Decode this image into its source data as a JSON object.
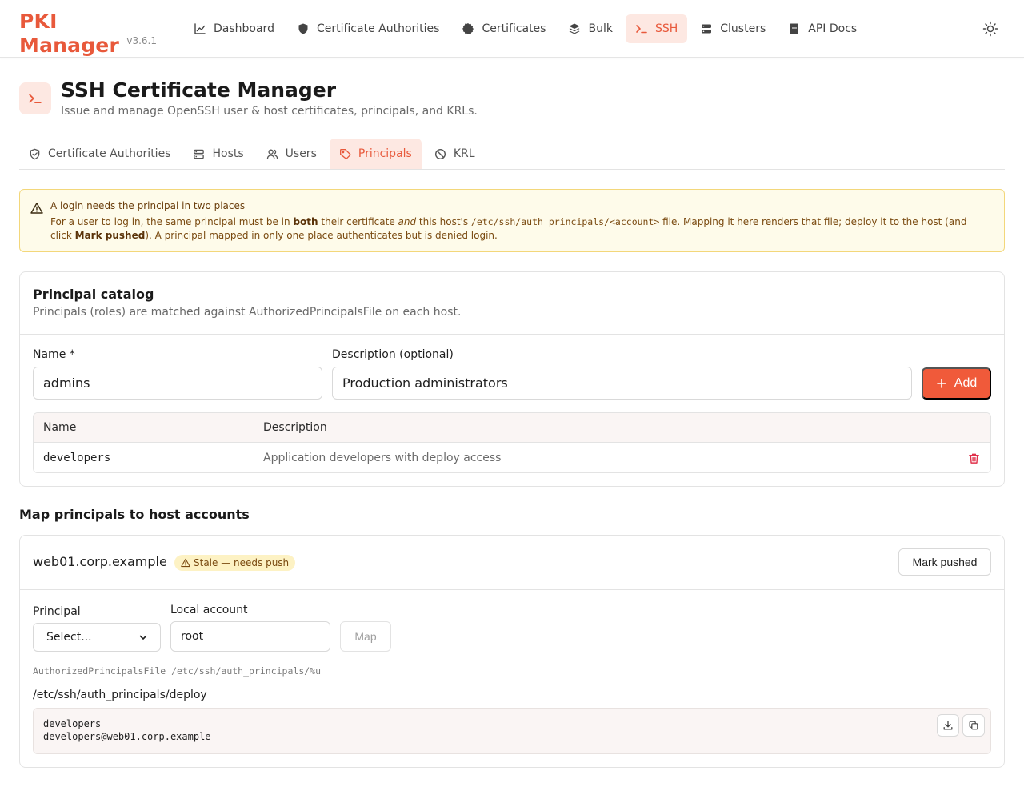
{
  "app": {
    "name": "PKI Manager",
    "version": "v3.6.1"
  },
  "nav": {
    "items": [
      {
        "label": "Dashboard",
        "icon": "chart-line-icon",
        "active": false
      },
      {
        "label": "Certificate Authorities",
        "icon": "shield-icon",
        "active": false
      },
      {
        "label": "Certificates",
        "icon": "badge-icon",
        "active": false
      },
      {
        "label": "Bulk",
        "icon": "layers-icon",
        "active": false
      },
      {
        "label": "SSH",
        "icon": "terminal-icon",
        "active": true
      },
      {
        "label": "Clusters",
        "icon": "server-icon",
        "active": false
      },
      {
        "label": "API Docs",
        "icon": "book-icon",
        "active": false
      }
    ],
    "theme_icon": "sun-icon"
  },
  "page": {
    "title": "SSH Certificate Manager",
    "subtitle": "Issue and manage OpenSSH user & host certificates, principals, and KRLs."
  },
  "subtabs": [
    {
      "label": "Certificate Authorities",
      "icon": "shield-check-icon",
      "active": false
    },
    {
      "label": "Hosts",
      "icon": "server-icon",
      "active": false
    },
    {
      "label": "Users",
      "icon": "users-icon",
      "active": false
    },
    {
      "label": "Principals",
      "icon": "tag-icon",
      "active": true
    },
    {
      "label": "KRL",
      "icon": "ban-icon",
      "active": false
    }
  ],
  "alert": {
    "title": "A login needs the principal in two places",
    "t1": "For a user to log in, the same principal must be in ",
    "b1": "both",
    "t2": " their certificate ",
    "i1": "and",
    "t3": " this host's ",
    "code": "/etc/ssh/auth_principals/<account>",
    "t4": " file. Mapping it here renders that file; deploy it to the host (and click ",
    "b2": "Mark pushed",
    "t5": "). A principal mapped in only one place authenticates but is denied login."
  },
  "catalog": {
    "title": "Principal catalog",
    "description": "Principals (roles) are matched against AuthorizedPrincipalsFile on each host.",
    "name_label": "Name *",
    "name_value": "admins",
    "desc_label": "Description (optional)",
    "desc_value": "Production administrators",
    "add_label": "Add",
    "table": {
      "headers": [
        "Name",
        "Description"
      ],
      "rows": [
        {
          "name": "developers",
          "description": "Application developers with deploy access"
        }
      ]
    }
  },
  "mapping": {
    "section_title": "Map principals to host accounts",
    "host": "web01.corp.example",
    "badge": "Stale — needs push",
    "mark_pushed_label": "Mark pushed",
    "principal_label": "Principal",
    "principal_selected": "Select...",
    "account_label": "Local account",
    "account_value": "root",
    "map_label": "Map",
    "authorized_file_line": "AuthorizedPrincipalsFile /etc/ssh/auth_principals/%u",
    "file_path": "/etc/ssh/auth_principals/deploy",
    "file_lines": [
      "developers",
      "developers@web01.corp.example"
    ]
  },
  "colors": {
    "accent": "#e8593b",
    "accent_bg": "#fde8e2",
    "warning_bg": "#fefbea",
    "warning_border": "#f3d77a",
    "danger": "#e0304a"
  }
}
